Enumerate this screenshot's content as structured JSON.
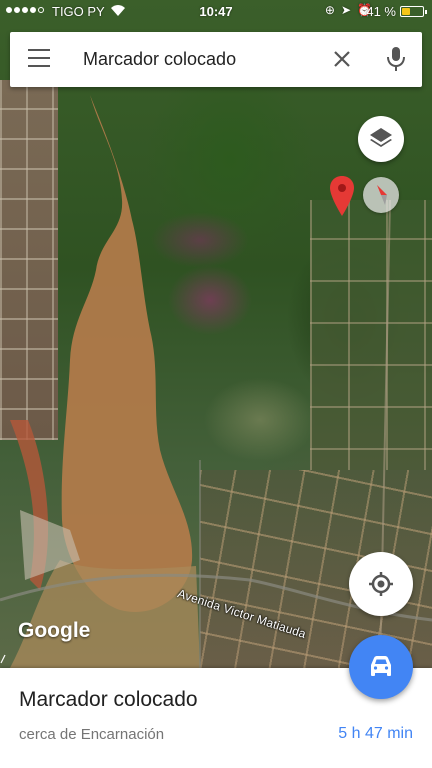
{
  "status_bar": {
    "carrier": "TIGO PY",
    "time": "10:47",
    "battery_percent": "41 %",
    "battery_level": 0.41,
    "signal_bars_filled": 4,
    "signal_bars_total": 5
  },
  "search": {
    "query": "Marcador colocado"
  },
  "map": {
    "road_label": "Avenida Victor Matiauda",
    "logo": "Google"
  },
  "place": {
    "title": "Marcador colocado",
    "subtitle": "cerca de Encarnación",
    "travel_time": "5 h 47 min"
  },
  "colors": {
    "accent": "#4285f4",
    "pin": "#e53935",
    "battery": "#f5c518"
  },
  "icons": {
    "menu": "menu-icon",
    "close": "close-icon",
    "mic": "mic-icon",
    "layers": "layers-icon",
    "compass": "compass-icon",
    "pin": "map-pin-icon",
    "my_location": "my-location-icon",
    "directions": "car-icon"
  }
}
